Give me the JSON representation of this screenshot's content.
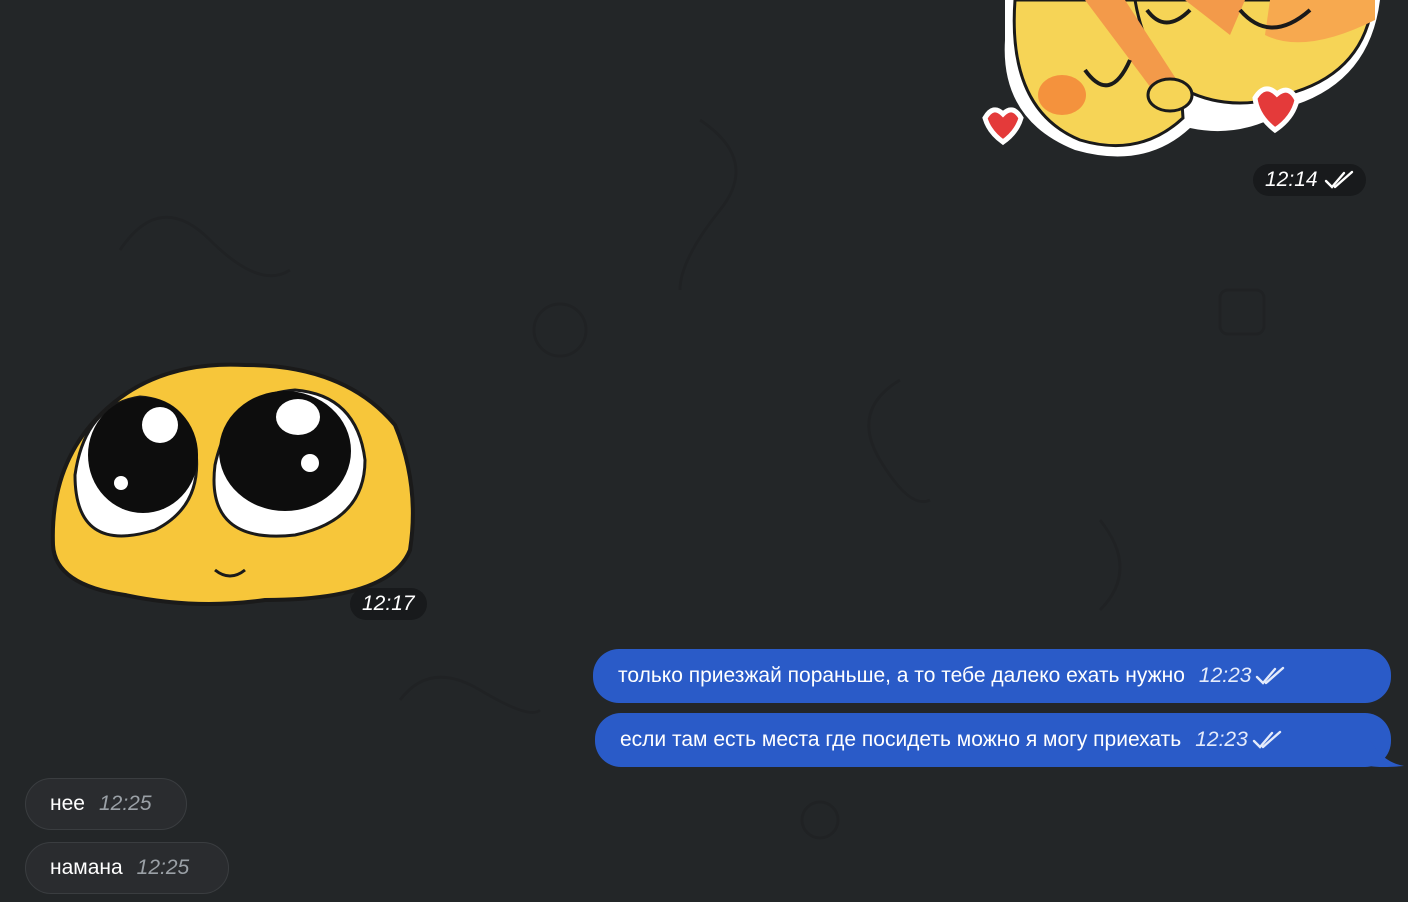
{
  "messages": [
    {
      "id": "sticker-hug",
      "type": "sticker",
      "direction": "out",
      "sticker": "hug-sticker",
      "time": "12:14",
      "status": "read"
    },
    {
      "id": "sticker-eyes",
      "type": "sticker",
      "direction": "in",
      "sticker": "big-eyes-sticker",
      "time": "12:17"
    },
    {
      "id": "msg-1",
      "type": "text",
      "direction": "out",
      "text": "только приезжай пораньше, а то тебе далеко ехать нужно",
      "time": "12:23",
      "status": "read"
    },
    {
      "id": "msg-2",
      "type": "text",
      "direction": "out",
      "text": "если там есть места где посидеть можно я могу приехать",
      "time": "12:23",
      "status": "read"
    },
    {
      "id": "msg-3",
      "type": "text",
      "direction": "in",
      "text": "нее",
      "time": "12:25"
    },
    {
      "id": "msg-4",
      "type": "text",
      "direction": "in",
      "text": "намана",
      "time": "12:25"
    }
  ],
  "colors": {
    "background": "#232628",
    "outgoing_bubble": "#2a5bc8",
    "incoming_bubble": "#2a2c2f",
    "time_pill": "#181a1c"
  }
}
